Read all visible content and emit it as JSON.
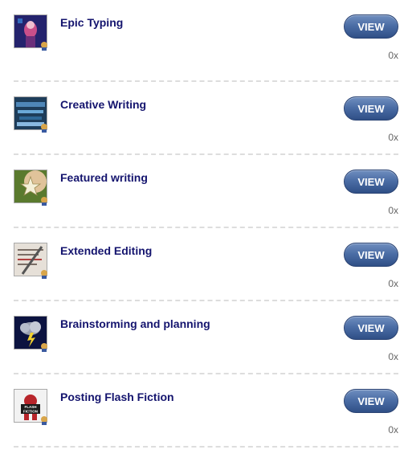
{
  "items": [
    {
      "title": "Epic Typing",
      "button": "VIEW",
      "count": "0x",
      "thumb_icon": "epic-typing-thumbnail"
    },
    {
      "title": "Creative Writing",
      "button": "VIEW",
      "count": "0x",
      "thumb_icon": "creative-writing-thumbnail"
    },
    {
      "title": "Featured writing",
      "button": "VIEW",
      "count": "0x",
      "thumb_icon": "featured-writing-thumbnail"
    },
    {
      "title": "Extended Editing",
      "button": "VIEW",
      "count": "0x",
      "thumb_icon": "extended-editing-thumbnail"
    },
    {
      "title": "Brainstorming and planning",
      "button": "VIEW",
      "count": "0x",
      "thumb_icon": "brainstorming-thumbnail"
    },
    {
      "title": "Posting Flash Fiction",
      "button": "VIEW",
      "count": "0x",
      "thumb_icon": "flash-fiction-thumbnail",
      "thumb_text": "FLASH FICTION"
    }
  ],
  "colors": {
    "title": "#14146e",
    "button": "#4c6ea6",
    "count": "#666666",
    "divider": "#dddddd"
  }
}
